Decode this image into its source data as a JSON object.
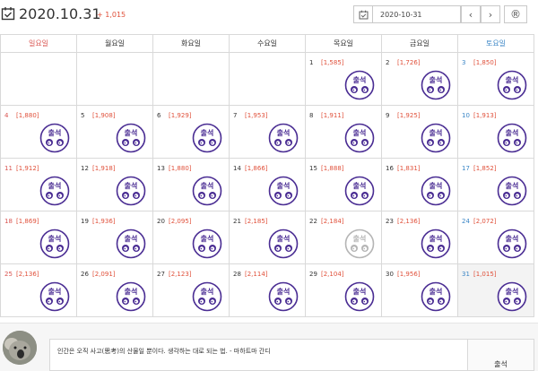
{
  "header": {
    "date": "2020.10.31",
    "count": "+ 1,015"
  },
  "picker": {
    "value": "2020-10-31",
    "prev": "‹",
    "next": "›",
    "r": "®"
  },
  "colors": {
    "sunday": "#d9534f",
    "saturday": "#3b86c6",
    "weekday": "#333333",
    "count_weekend": "#e0503a",
    "count_weekday": "#e0503a",
    "stamp": "#4a2d93"
  },
  "weekdays": [
    "일요일",
    "월요일",
    "화요일",
    "수요일",
    "목요일",
    "금요일",
    "토요일"
  ],
  "stamp_text": "출석",
  "days": [
    {
      "num": "1",
      "count": "[1,585]"
    },
    {
      "num": "2",
      "count": "[1,726]"
    },
    {
      "num": "3",
      "count": "[1,850]"
    },
    {
      "num": "4",
      "count": "[1,880]"
    },
    {
      "num": "5",
      "count": "[1,908]"
    },
    {
      "num": "6",
      "count": "[1,929]"
    },
    {
      "num": "7",
      "count": "[1,953]"
    },
    {
      "num": "8",
      "count": "[1,911]"
    },
    {
      "num": "9",
      "count": "[1,925]"
    },
    {
      "num": "10",
      "count": "[1,913]"
    },
    {
      "num": "11",
      "count": "[1,912]"
    },
    {
      "num": "12",
      "count": "[1,918]"
    },
    {
      "num": "13",
      "count": "[1,880]"
    },
    {
      "num": "14",
      "count": "[1,866]"
    },
    {
      "num": "15",
      "count": "[1,888]"
    },
    {
      "num": "16",
      "count": "[1,831]"
    },
    {
      "num": "17",
      "count": "[1,852]"
    },
    {
      "num": "18",
      "count": "[1,869]"
    },
    {
      "num": "19",
      "count": "[1,936]"
    },
    {
      "num": "20",
      "count": "[2,095]"
    },
    {
      "num": "21",
      "count": "[2,185]"
    },
    {
      "num": "22",
      "count": "[2,184]",
      "faded": true
    },
    {
      "num": "23",
      "count": "[2,136]"
    },
    {
      "num": "24",
      "count": "[2,072]"
    },
    {
      "num": "25",
      "count": "[2,136]"
    },
    {
      "num": "26",
      "count": "[2,091]"
    },
    {
      "num": "27",
      "count": "[2,123]"
    },
    {
      "num": "28",
      "count": "[2,114]"
    },
    {
      "num": "29",
      "count": "[2,104]"
    },
    {
      "num": "30",
      "count": "[1,956]"
    },
    {
      "num": "31",
      "count": "[1,015]",
      "today": true
    }
  ],
  "footer": {
    "comment": "인간은 오직 사고(思考)의 산물일 뿐이다. 생각하는 대로 되는 법. - 마하트마 간디",
    "submit": "출석"
  }
}
